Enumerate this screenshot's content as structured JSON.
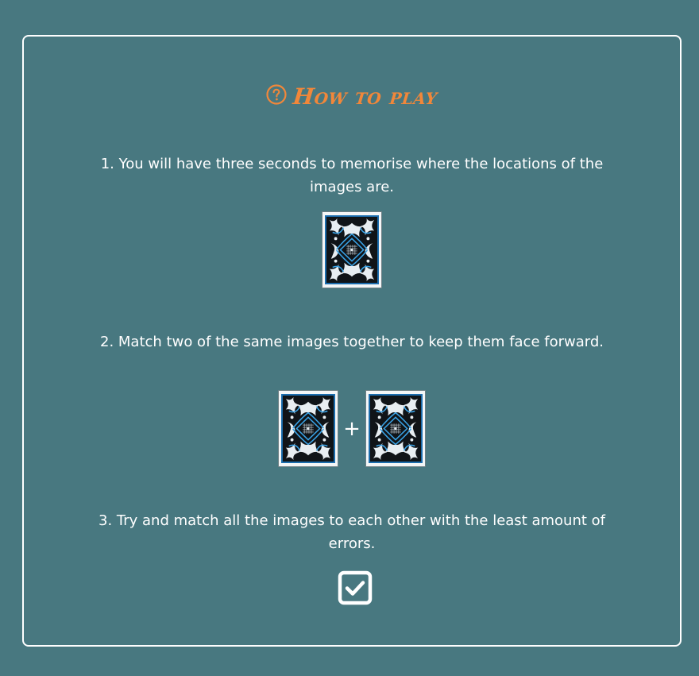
{
  "title": {
    "icon": "question-circle-icon",
    "text": "How to play",
    "color": "#f1873a"
  },
  "steps": [
    {
      "text": "1. You will have three seconds to memorise where the locations of the images are."
    },
    {
      "text": "2. Match two of the same images together to keep them face forward."
    },
    {
      "text": "3. Try and match all the images to each other with the least amount of errors."
    }
  ],
  "plus_symbol": "+",
  "icons": {
    "card": "card-back-image",
    "check": "checkbox-checked-icon"
  },
  "colors": {
    "background": "#487880",
    "accent": "#f1873a",
    "card_blue": "#2a8fd0"
  }
}
